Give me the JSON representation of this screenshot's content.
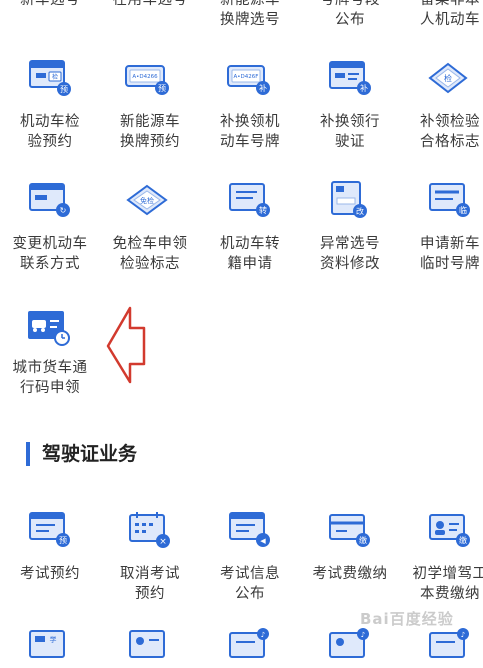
{
  "colors": {
    "accent": "#2e6bd6",
    "icon_light": "#dfe9fb",
    "arrow": "#d23a2e"
  },
  "top_row": [
    {
      "lines": [
        "新车选号"
      ]
    },
    {
      "lines": [
        "在用车选号"
      ]
    },
    {
      "lines": [
        "新能源车",
        "换牌选号"
      ]
    },
    {
      "lines": [
        "号牌号段",
        "公布"
      ]
    },
    {
      "lines": [
        "留菜非本",
        "人机动车"
      ]
    }
  ],
  "row1": [
    {
      "icon": "vehicle-inspection-card-icon",
      "badge": "检",
      "badge2": "预",
      "lines": [
        "机动车检",
        "验预约"
      ]
    },
    {
      "icon": "new-energy-plate-icon",
      "badge": "A•D4266",
      "badge2": "预",
      "lines": [
        "新能源车",
        "换牌预约"
      ]
    },
    {
      "icon": "replace-plate-icon",
      "badge": "A•D426F",
      "badge2": "补",
      "lines": [
        "补换领机",
        "动车号牌"
      ]
    },
    {
      "icon": "replace-license-icon",
      "badge": "",
      "badge2": "补",
      "lines": [
        "补换领行",
        "驶证"
      ]
    },
    {
      "icon": "inspection-sticker-icon",
      "badge": "检",
      "badge2": "",
      "lines": [
        "补领检验",
        "合格标志"
      ]
    }
  ],
  "row2": [
    {
      "icon": "change-contact-icon",
      "badge": "",
      "badge2": "↻",
      "lines": [
        "变更机动车",
        "联系方式"
      ]
    },
    {
      "icon": "exempt-inspection-icon",
      "badge": "免检",
      "badge2": "",
      "lines": [
        "免检车申领",
        "检验标志"
      ]
    },
    {
      "icon": "transfer-register-icon",
      "badge": "",
      "badge2": "转",
      "lines": [
        "机动车转",
        "籍申请"
      ]
    },
    {
      "icon": "abnormal-plate-edit-icon",
      "badge": "",
      "badge2": "改",
      "lines": [
        "异常选号",
        "资料修改"
      ]
    },
    {
      "icon": "temporary-plate-icon",
      "badge": "",
      "badge2": "临",
      "lines": [
        "申请新车",
        "临时号牌"
      ]
    }
  ],
  "row3": [
    {
      "icon": "city-truck-pass-icon",
      "badge": "",
      "badge2": "",
      "lines": [
        "城市货车通",
        "行码申领"
      ]
    }
  ],
  "section": {
    "title": "驾驶证业务"
  },
  "row4": [
    {
      "icon": "exam-appointment-icon",
      "badge": "",
      "badge2": "预",
      "lines": [
        "考试预约"
      ]
    },
    {
      "icon": "cancel-exam-icon",
      "badge": "",
      "badge2": "×",
      "lines": [
        "取消考试",
        "预约"
      ]
    },
    {
      "icon": "exam-info-icon",
      "badge": "",
      "badge2": "◀",
      "lines": [
        "考试信息",
        "公布"
      ]
    },
    {
      "icon": "exam-fee-icon",
      "badge": "",
      "badge2": "缴",
      "lines": [
        "考试费缴纳"
      ]
    },
    {
      "icon": "learner-fee-icon",
      "badge": "",
      "badge2": "缴",
      "lines": [
        "初学增驾工",
        "本费缴纳"
      ]
    }
  ],
  "row5": [
    {
      "icon": "learner-card-icon",
      "badge": "学",
      "badge2": ""
    },
    {
      "icon": "id-card-icon",
      "badge": "",
      "badge2": ""
    },
    {
      "icon": "id-card-audio-icon",
      "badge": "",
      "badge2": "♪"
    },
    {
      "icon": "person-card-icon",
      "badge": "",
      "badge2": "♪"
    },
    {
      "icon": "card-audio-icon",
      "badge": "",
      "badge2": "♪"
    }
  ],
  "watermark": "Bai百度经验"
}
